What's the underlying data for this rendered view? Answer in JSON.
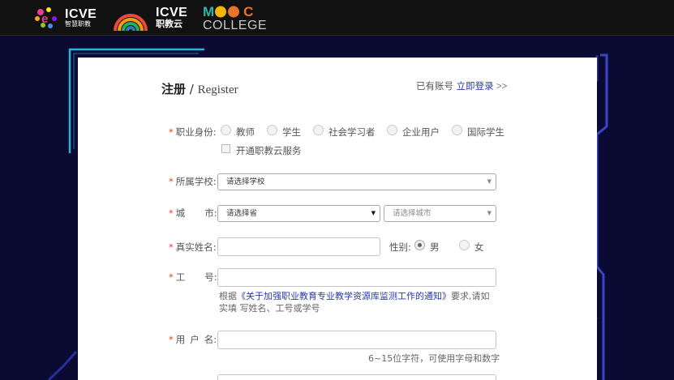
{
  "header": {
    "icve_zhjj": {
      "main": "ICVE",
      "sub": "智慧职教"
    },
    "icve_zjy": {
      "main": "ICVE",
      "sub": "职教云"
    },
    "mooc_college": {
      "m": "M",
      "d": "C",
      "college": "COLLEGE"
    }
  },
  "form": {
    "title_cn": "注册",
    "title_sep": " / ",
    "title_en": "Register",
    "login_prefix": "已有账号 ",
    "login_link": "立即登录",
    "login_arrows": " >>",
    "required_mark": "*",
    "identity": {
      "label": "职业身份:",
      "options": [
        "教师",
        "学生",
        "社会学习者",
        "企业用户",
        "国际学生"
      ],
      "service_checkbox": "开通职教云服务"
    },
    "school": {
      "label": "所属学校:",
      "placeholder": "请选择学校"
    },
    "city": {
      "label_a": "城",
      "label_b": "市:",
      "province": "请选择省",
      "city": "请选择城市"
    },
    "real_name": {
      "label": "真实姓名:"
    },
    "gender": {
      "label": "性别:",
      "options": [
        "男",
        "女"
      ],
      "selected": "男"
    },
    "work_id": {
      "label_a": "工",
      "label_b": "号:",
      "note_prefix": "根据",
      "note_link": "《关于加强职业教育专业教学资源库监测工作的通知》",
      "note_suffix": "要求,请如",
      "note_line2": "实填 写姓名、工号或学号"
    },
    "username": {
      "label_a": "用",
      "label_b": "户",
      "label_c": "名:",
      "hint": "6~15位字符，可使用字母和数字"
    }
  },
  "colors": {
    "background": "#0a0a32",
    "accent_link": "#2a3aa8",
    "required": "#e0452b"
  }
}
